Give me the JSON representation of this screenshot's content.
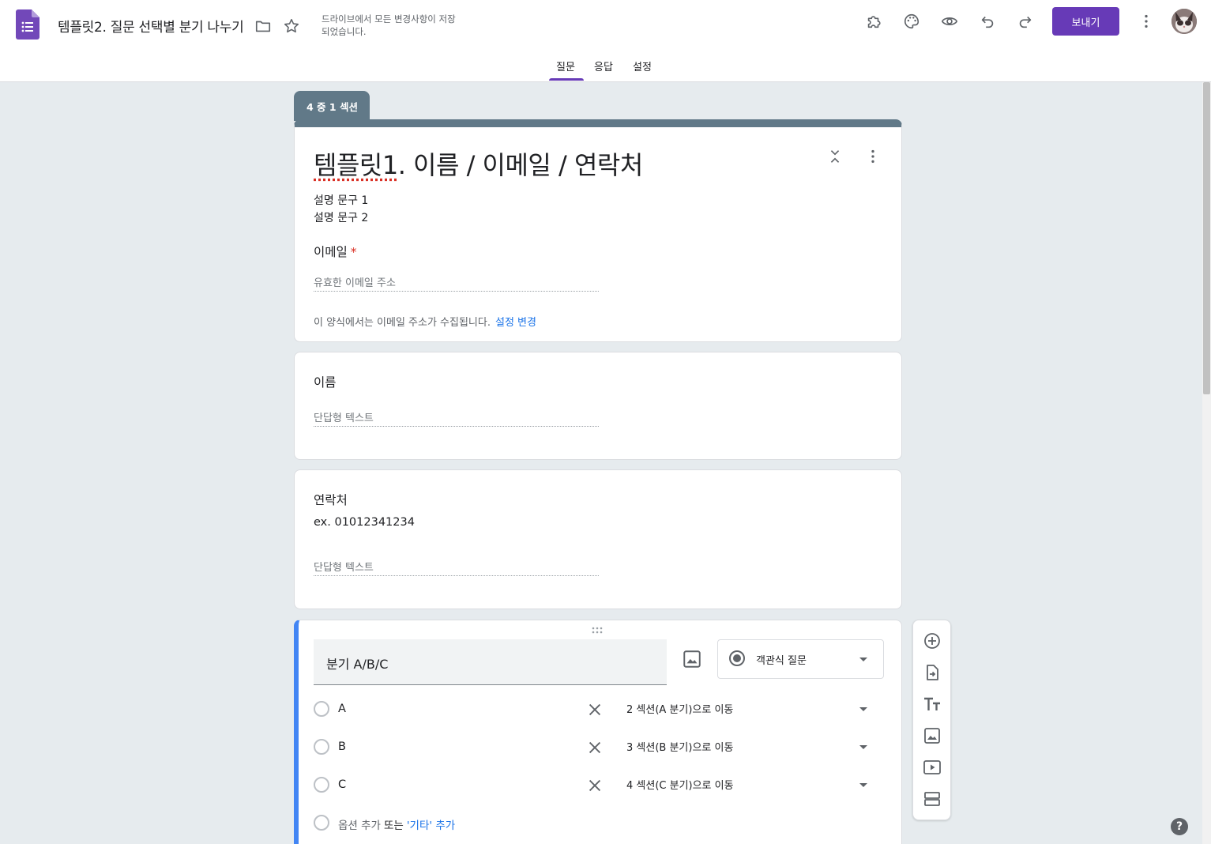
{
  "header": {
    "doc_title": "템플릿2. 질문 선택별 분기 나누기",
    "save_status": "드라이브에서 모든 변경사항이 저장되었습니다.",
    "send_label": "보내기"
  },
  "tabs": [
    {
      "label": "질문",
      "active": true
    },
    {
      "label": "응답",
      "active": false
    },
    {
      "label": "설정",
      "active": false
    }
  ],
  "accent_color": "#673ab7",
  "section": {
    "tag": "4 중 1 섹션",
    "title_part1": "템플릿1",
    "title_part2": ". 이름 / 이메일 / 연락처",
    "desc_line1": "설명 문구 1",
    "desc_line2": "설명 문구 2",
    "email_label": "이메일",
    "required_mark": "*",
    "email_placeholder": "유효한 이메일 주소",
    "email_note": "이 양식에서는 이메일 주소가 수집됩니다.",
    "email_note_link": "설정 변경"
  },
  "q_name": {
    "label": "이름",
    "placeholder": "단답형 텍스트"
  },
  "q_contact": {
    "label": "연락처",
    "help": "ex. 01012341234",
    "placeholder": "단답형 텍스트"
  },
  "q_branch": {
    "title": "분기 A/B/C",
    "type": "객관식 질문",
    "options": [
      {
        "label": "A",
        "goto": "2 섹션(A 분기)으로 이동"
      },
      {
        "label": "B",
        "goto": "3 섹션(B 분기)으로 이동"
      },
      {
        "label": "C",
        "goto": "4 섹션(C 분기)으로 이동"
      }
    ],
    "add_option": "옵션 추가",
    "or": "또는",
    "add_other": "'기타' 추가"
  },
  "help_label": "?"
}
